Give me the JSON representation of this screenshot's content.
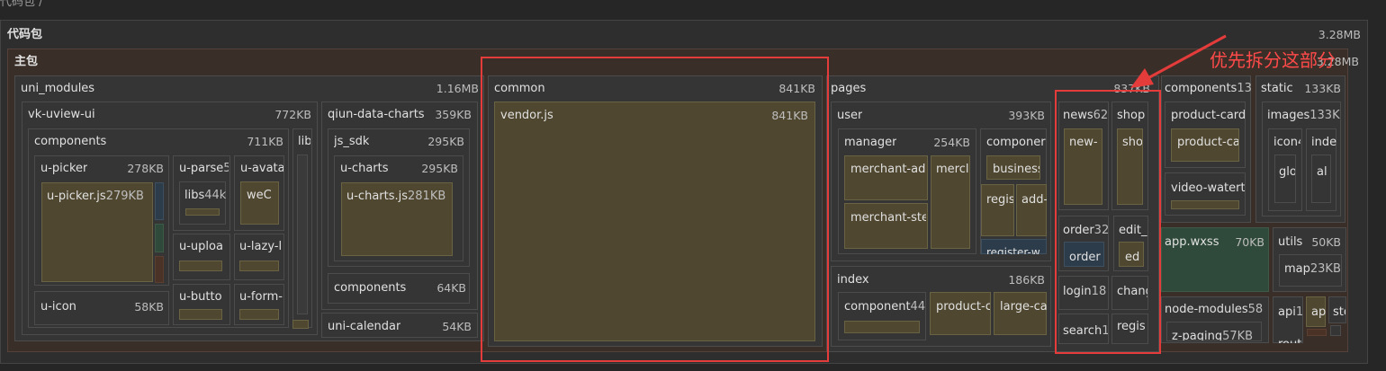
{
  "breadcrumb": "代码包 /",
  "root": {
    "label": "代码包",
    "size": "3.28MB"
  },
  "main_pkg": {
    "label": "主包",
    "size": "3.28MB"
  },
  "uni_modules": {
    "label": "uni_modules",
    "size": "1.16MB"
  },
  "vk": {
    "label": "vk-uview-ui",
    "size": "772KB"
  },
  "components": {
    "label": "components",
    "size": "711KB"
  },
  "lib": {
    "label": "lib"
  },
  "upicker": {
    "label": "u-picker",
    "size": "278KB"
  },
  "upickerjs": {
    "label": "u-picker.js",
    "size": "279KB"
  },
  "uparse": {
    "label": "u-parse",
    "size": "5"
  },
  "libs44": {
    "label": "libs",
    "size": "44k"
  },
  "uavatar": {
    "label": "u-avata"
  },
  "wec": {
    "label": "weC"
  },
  "uupload": {
    "label": "u-uploa"
  },
  "ulazy": {
    "label": "u-lazy-l"
  },
  "ubutton": {
    "label": "u-butto"
  },
  "uform": {
    "label": "u-form-"
  },
  "uicon": {
    "label": "u-icon",
    "size": "58KB"
  },
  "qiun": {
    "label": "qiun-data-charts",
    "size": "359KB"
  },
  "jssdk": {
    "label": "js_sdk",
    "size": "295KB"
  },
  "ucharts": {
    "label": "u-charts",
    "size": "295KB"
  },
  "uchartsjs": {
    "label": "u-charts.js",
    "size": "281KB"
  },
  "qcomponents": {
    "label": "components",
    "size": "64KB"
  },
  "unicalendar": {
    "label": "uni-calendar",
    "size": "54KB"
  },
  "common": {
    "label": "common",
    "size": "841KB"
  },
  "vendor": {
    "label": "vendor.js",
    "size": "841KB"
  },
  "pages": {
    "label": "pages",
    "size": "837KB"
  },
  "user": {
    "label": "user",
    "size": "393KB"
  },
  "manager": {
    "label": "manager",
    "size": "254KB"
  },
  "merchantad": {
    "label": "merchant-ad"
  },
  "merch": {
    "label": "mercl"
  },
  "merchantste": {
    "label": "merchant-ste"
  },
  "ucomponents": {
    "label": "componer"
  },
  "business": {
    "label": "business"
  },
  "regis": {
    "label": "regis"
  },
  "add": {
    "label": "add-"
  },
  "registerw": {
    "label": "register-w"
  },
  "index": {
    "label": "index",
    "size": "186KB"
  },
  "icomponent": {
    "label": "component",
    "size": "44"
  },
  "productc": {
    "label": "product-c"
  },
  "largeca": {
    "label": "large-ca"
  },
  "news": {
    "label": "news",
    "size": "62"
  },
  "newsleaf": {
    "label": "new-"
  },
  "shop": {
    "label": "shop"
  },
  "shopleaf": {
    "label": "sho"
  },
  "order": {
    "label": "order",
    "size": "32"
  },
  "orderleaf": {
    "label": "order"
  },
  "edit": {
    "label": "edit_"
  },
  "editleaf": {
    "label": "ed"
  },
  "login": {
    "label": "login",
    "size": "18"
  },
  "chang": {
    "label": "chang"
  },
  "search": {
    "label": "search",
    "size": "1"
  },
  "regis2": {
    "label": "regis"
  },
  "components13": {
    "label": "components",
    "size": "13"
  },
  "productcard": {
    "label": "product-card"
  },
  "productca": {
    "label": "product-ca"
  },
  "videowater": {
    "label": "video-watert"
  },
  "static": {
    "label": "static",
    "size": "133KB"
  },
  "images": {
    "label": "images",
    "size": "133K"
  },
  "icon4": {
    "label": "icon4"
  },
  "inde": {
    "label": "inde"
  },
  "glo": {
    "label": "glo"
  },
  "al": {
    "label": "al"
  },
  "appwxss": {
    "label": "app.wxss",
    "size": "70KB"
  },
  "utils": {
    "label": "utils",
    "size": "50KB"
  },
  "map": {
    "label": "map",
    "size": "23KB"
  },
  "nodemodules": {
    "label": "node-modules",
    "size": "58"
  },
  "zpaging": {
    "label": "z-paging",
    "size": "57KB"
  },
  "api": {
    "label": "api",
    "size": "1"
  },
  "ap": {
    "label": "ap"
  },
  "st": {
    "label": "sto"
  },
  "rout": {
    "label": "rout"
  },
  "annotation": "优先拆分这部分",
  "colors": {
    "highlight": "#e43b3b",
    "leaf": "#4f472f",
    "green": "#2f4a3a"
  }
}
